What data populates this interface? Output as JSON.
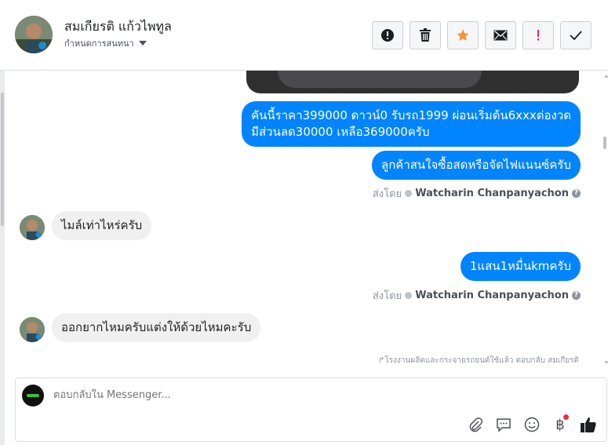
{
  "header": {
    "name": "สมเกียรติ แก้วไพทูล",
    "subtitle": "กำหนดการสนทนา",
    "actions": [
      {
        "name": "report-button",
        "icon": "exclamation-circle-icon"
      },
      {
        "name": "delete-button",
        "icon": "trash-icon"
      },
      {
        "name": "star-button",
        "icon": "star-icon",
        "color": "#f7923b"
      },
      {
        "name": "email-button",
        "icon": "envelope-icon"
      },
      {
        "name": "mark-important-button",
        "icon": "exclamation-icon",
        "color": "#e0245e"
      },
      {
        "name": "mark-done-button",
        "icon": "checkmark-icon"
      }
    ]
  },
  "conversation": {
    "messages": [
      {
        "direction": "out",
        "text_line1": "คันนี้ราคา399000 ดาวน์0 รับรถ1999 ผ่อนเริ่มต้น6xxxต่องวด",
        "text_line2": "มีส่วนลด30000 เหลือ369000ครับ"
      },
      {
        "direction": "out",
        "text": "ลูกค้าสนใจซื้อสดหรือจัดไฟแนนซ์ครับ"
      },
      {
        "direction": "in",
        "text": "ไมล์เท่าไหร่ครับ"
      },
      {
        "direction": "out",
        "text": "1แสน1หมื่นkmครับ"
      },
      {
        "direction": "in",
        "text": "ออกยากไหมครับแต่งให้ด้วยไหมคะรับ"
      }
    ],
    "sent_by_label": "ส่งโดย",
    "sent_by_name": "Watcharin Chanpanyachon",
    "help_glyph": "?",
    "reply_note": "โรงงานผลิตและกระจายรถยนต์ใช้แล้ว ตอบกลับ สมเกียรติ"
  },
  "composer": {
    "placeholder": "ตอบกลับใน Messenger...",
    "tools": [
      "paperclip-icon",
      "speech-bubble-icon",
      "smiley-icon",
      "baht-icon",
      "thumbs-up-icon"
    ],
    "baht_glyph": "฿",
    "accent": "#0084ff"
  },
  "colors": {
    "outgoing_bubble": "#0084ff",
    "incoming_bubble": "#f1f0f0"
  }
}
